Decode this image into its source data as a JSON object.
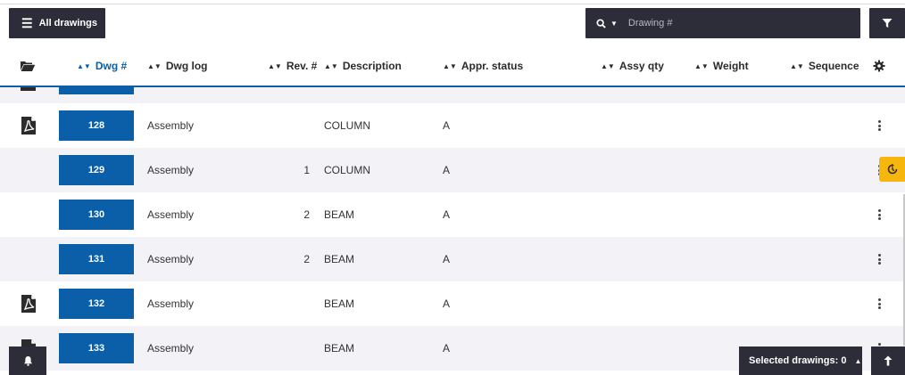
{
  "toolbar": {
    "all_drawings_label": "All drawings",
    "search_placeholder": "Drawing #"
  },
  "columns": {
    "dwg_num": "Dwg #",
    "dwg_log": "Dwg log",
    "rev_num": "Rev. #",
    "description": "Description",
    "appr_status": "Appr. status",
    "assy_qty": "Assy qty",
    "weight": "Weight",
    "sequence": "Sequence"
  },
  "rows": [
    {
      "dwg": "128",
      "log": "Assembly",
      "rev": "",
      "description": "COLUMN",
      "status": "A",
      "has_pdf": true
    },
    {
      "dwg": "129",
      "log": "Assembly",
      "rev": "1",
      "description": "COLUMN",
      "status": "A",
      "has_pdf": false
    },
    {
      "dwg": "130",
      "log": "Assembly",
      "rev": "2",
      "description": "BEAM",
      "status": "A",
      "has_pdf": false
    },
    {
      "dwg": "131",
      "log": "Assembly",
      "rev": "2",
      "description": "BEAM",
      "status": "A",
      "has_pdf": false
    },
    {
      "dwg": "132",
      "log": "Assembly",
      "rev": "",
      "description": "BEAM",
      "status": "A",
      "has_pdf": true
    },
    {
      "dwg": "133",
      "log": "Assembly",
      "rev": "",
      "description": "BEAM",
      "status": "A",
      "has_pdf": true
    }
  ],
  "footer": {
    "selected_label": "Selected drawings:",
    "selected_count": "0"
  },
  "colors": {
    "accent_blue": "#0b5ea8",
    "dark": "#2d2d3a",
    "highlight_yellow": "#f6b60d",
    "row_alt": "#f2f2f7"
  },
  "icons": {
    "menu": "hamburger-icon",
    "search": "search-icon",
    "filter": "filter-icon",
    "folder": "folder-open-icon",
    "settings": "gear-icon",
    "pdf": "pdf-file-icon",
    "row_menu": "kebab-icon",
    "history": "history-icon",
    "notifications": "bell-icon",
    "scroll_top": "arrow-up-icon"
  }
}
